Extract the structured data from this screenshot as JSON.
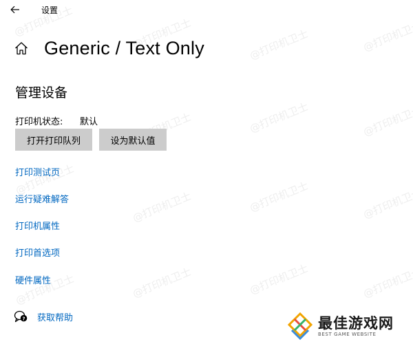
{
  "window": {
    "title": "设置"
  },
  "header": {
    "title": "Generic / Text Only"
  },
  "section": {
    "title": "管理设备"
  },
  "status": {
    "label": "打印机状态:",
    "value": "默认"
  },
  "buttons": {
    "open_queue": "打开打印队列",
    "set_default": "设为默认值"
  },
  "links": [
    {
      "label": "打印测试页"
    },
    {
      "label": "运行疑难解答"
    },
    {
      "label": "打印机属性"
    },
    {
      "label": "打印首选项"
    },
    {
      "label": "硬件属性"
    }
  ],
  "help": {
    "label": "获取帮助"
  },
  "watermark": {
    "text": "@打印机卫士"
  },
  "logo": {
    "name": "最佳游戏网",
    "tagline": "BEST GAME WEBSITE"
  },
  "colors": {
    "link": "#0067c0",
    "button_bg": "#cccccc",
    "background": "#ffffff"
  },
  "icons": {
    "back": "back-arrow-icon",
    "home": "home-icon",
    "help": "help-chat-icon"
  }
}
